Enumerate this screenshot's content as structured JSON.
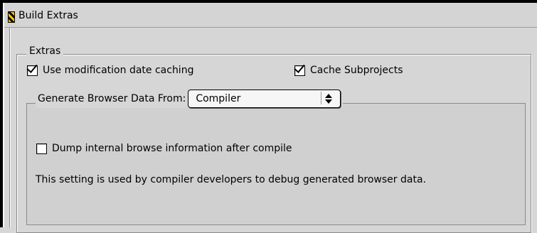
{
  "window": {
    "title": "Build Extras"
  },
  "extras": {
    "legend": "Extras",
    "use_mod_date_caching": {
      "label": "Use modification date caching",
      "checked": true
    },
    "cache_subprojects": {
      "label": "Cache Subprojects",
      "checked": true
    }
  },
  "browser": {
    "legend": "Generate Browser Data From:",
    "popup_value": "Compiler",
    "dump_info": {
      "label": "Dump internal browse information after compile",
      "checked": false
    },
    "note": "This setting is used by compiler developers to debug generated browser data."
  }
}
